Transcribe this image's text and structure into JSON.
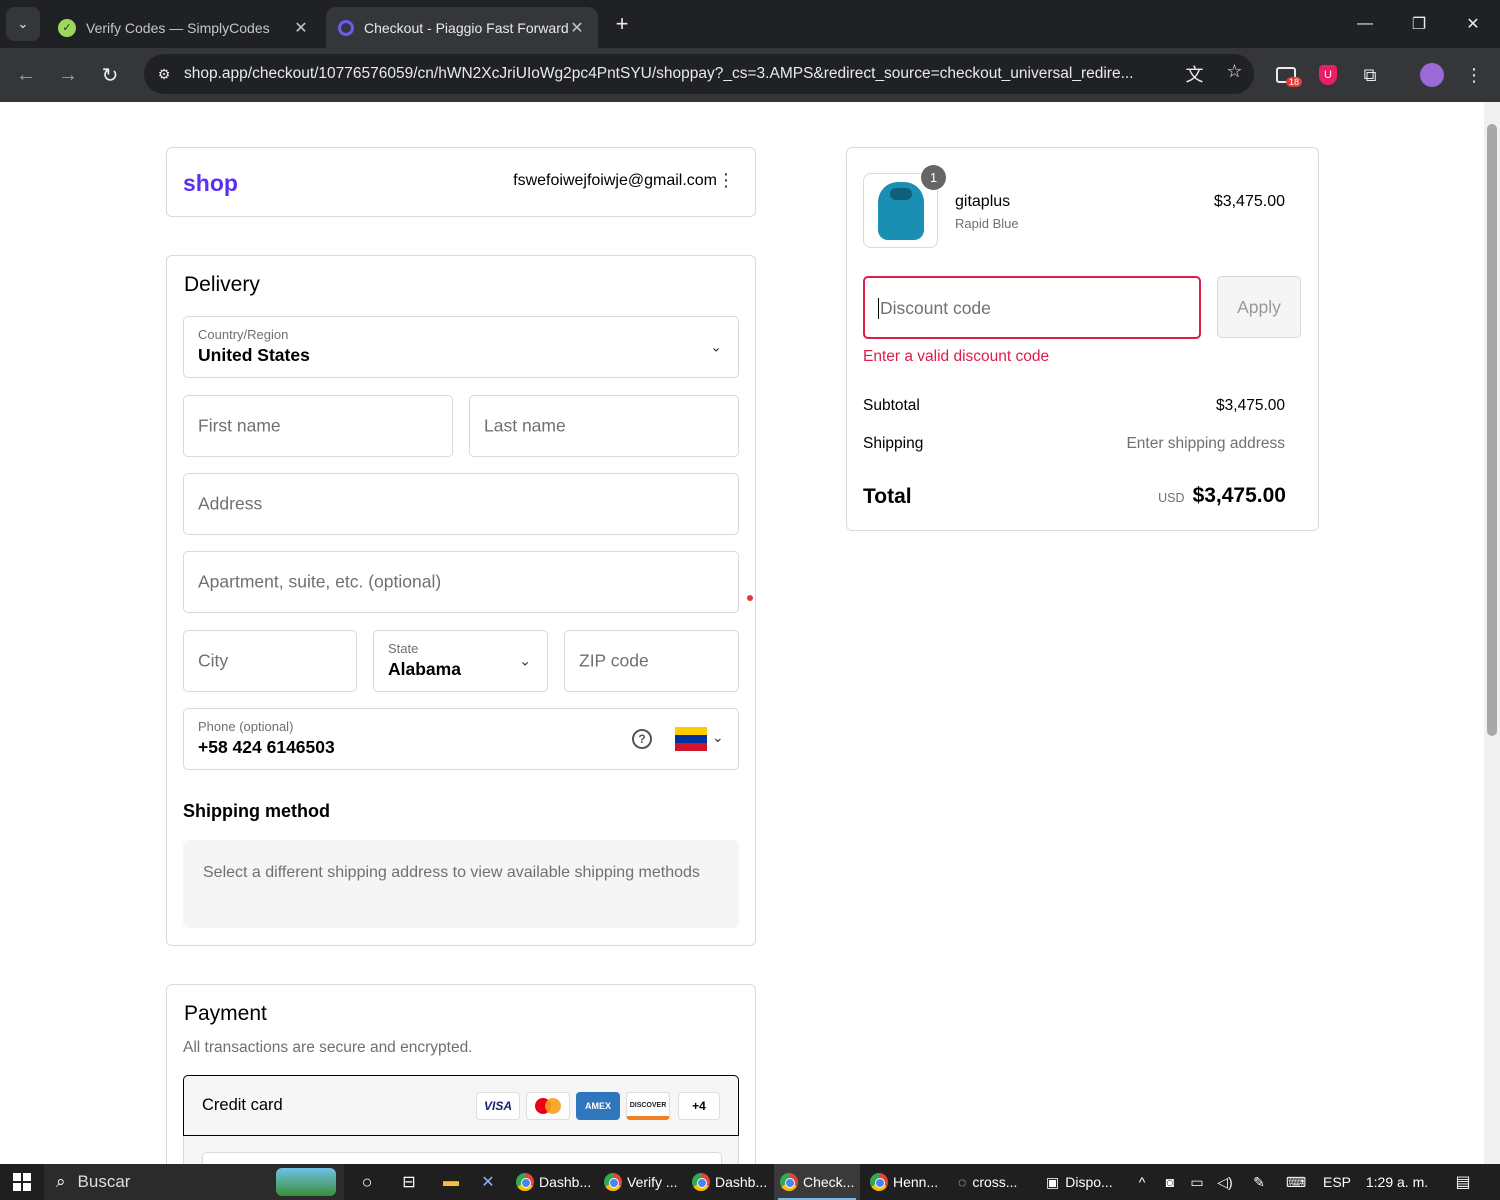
{
  "browser": {
    "tabs": [
      {
        "title": "Verify Codes — SimplyCodes",
        "active": false
      },
      {
        "title": "Checkout - Piaggio Fast Forward",
        "active": true
      }
    ],
    "url": "shop.app/checkout/10776576059/cn/hWN2XcJriUIoWg2pc4PntSYU/shoppay?_cs=3.AMPS&redirect_source=checkout_universal_redire...",
    "extension_badge": "18"
  },
  "header": {
    "logo": "shop",
    "email": "fswefoiwejfoiwje@gmail.com"
  },
  "delivery": {
    "title": "Delivery",
    "country_label": "Country/Region",
    "country_value": "United States",
    "first_name_placeholder": "First name",
    "last_name_placeholder": "Last name",
    "address_placeholder": "Address",
    "apartment_placeholder": "Apartment, suite, etc. (optional)",
    "city_placeholder": "City",
    "state_label": "State",
    "state_value": "Alabama",
    "zip_placeholder": "ZIP code",
    "phone_label": "Phone (optional)",
    "phone_value": "+58 424 6146503"
  },
  "shipping_method": {
    "title": "Shipping method",
    "message": "Select a different shipping address to view available shipping methods"
  },
  "payment": {
    "title": "Payment",
    "subtitle": "All transactions are secure and encrypted.",
    "credit_card_label": "Credit card",
    "card_brands": [
      "VISA",
      "DISCOVER",
      "AMEX"
    ],
    "more_cards": "+4"
  },
  "summary": {
    "item_qty": "1",
    "item_name": "gitaplus",
    "item_variant": "Rapid Blue",
    "item_price": "$3,475.00",
    "discount_placeholder": "Discount code",
    "apply_label": "Apply",
    "discount_error": "Enter a valid discount code",
    "subtotal_label": "Subtotal",
    "subtotal_value": "$3,475.00",
    "shipping_label": "Shipping",
    "shipping_value": "Enter shipping address",
    "total_label": "Total",
    "total_currency": "USD",
    "total_value": "$3,475.00"
  },
  "taskbar": {
    "search": "Buscar",
    "apps": [
      "Dashb...",
      "Verify ...",
      "Dashb...",
      "Check...",
      "Henn...",
      "cross...",
      "Dispo..."
    ],
    "language": "ESP",
    "time": "1:29 a. m."
  },
  "colors": {
    "shop_purple": "#5a31f4",
    "error": "#dd1d4a",
    "chrome_dark": "#202124"
  }
}
